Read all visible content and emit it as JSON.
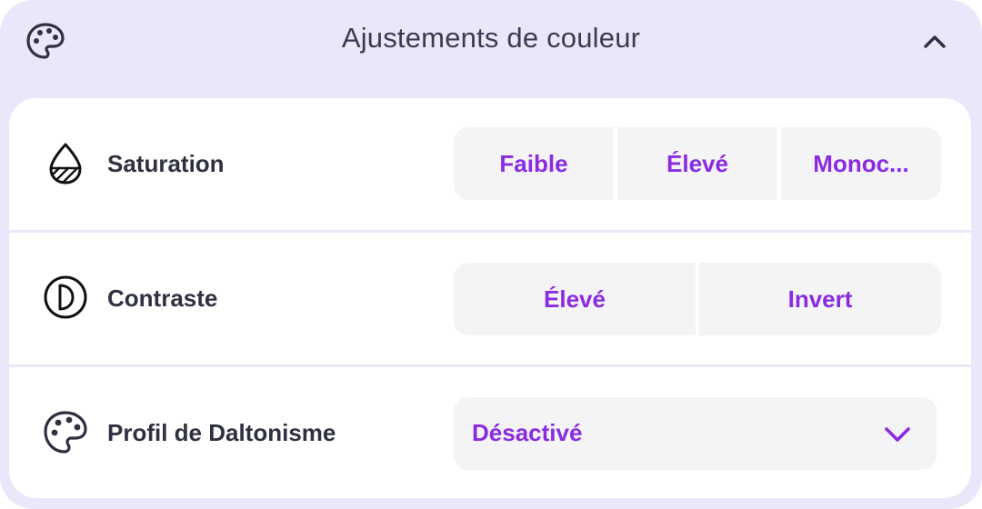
{
  "header": {
    "title": "Ajustements de couleur",
    "icon": "palette-icon",
    "collapse_icon": "chevron-up-icon"
  },
  "rows": {
    "saturation": {
      "label": "Saturation",
      "icon": "droplet-half-icon",
      "options": [
        "Faible",
        "Élevé",
        "Monoc..."
      ]
    },
    "contrast": {
      "label": "Contraste",
      "icon": "contrast-circle-icon",
      "options": [
        "Élevé",
        "Invert"
      ]
    },
    "colorblind": {
      "label": "Profil de Daltonisme",
      "icon": "palette-icon",
      "selected": "Désactivé",
      "dropdown_icon": "chevron-down-icon"
    }
  },
  "colors": {
    "panel_bg": "#ece6fb",
    "card_bg": "#ffffff",
    "accent": "#8a2be2",
    "text": "#2f3140",
    "segment_bg": "#f4f4f6"
  }
}
